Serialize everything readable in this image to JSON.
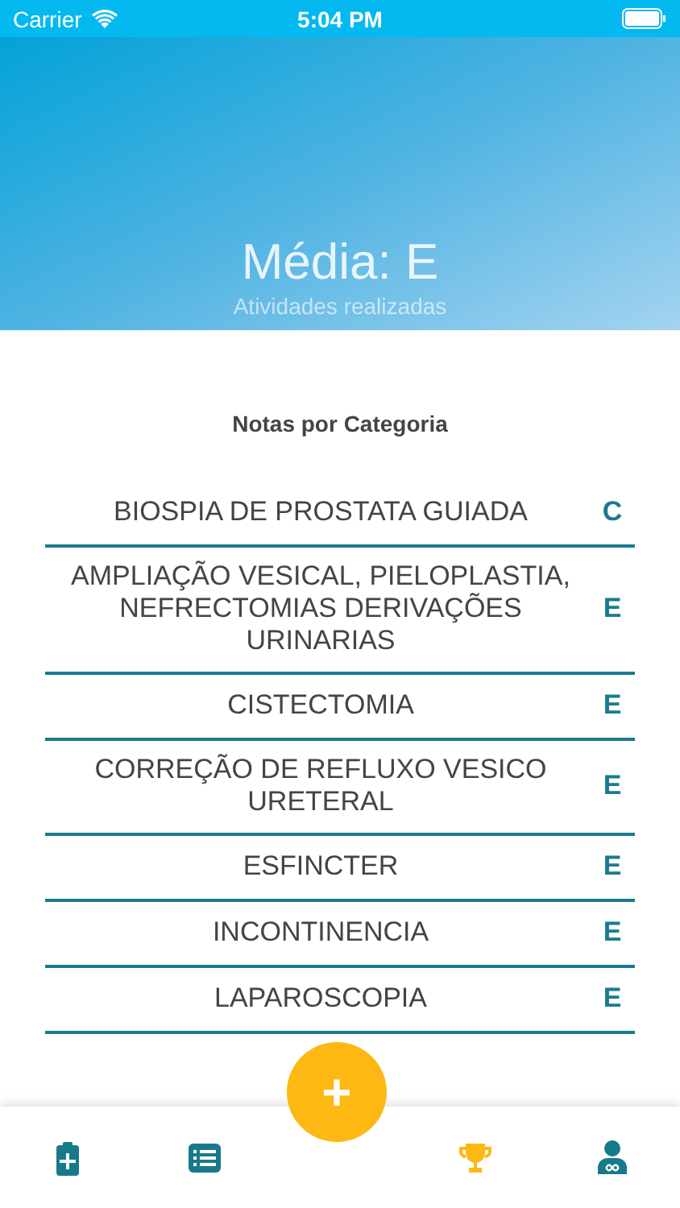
{
  "status_bar": {
    "carrier": "Carrier",
    "time": "5:04 PM"
  },
  "header": {
    "title": "Média: E",
    "subtitle": "Atividades realizadas"
  },
  "section_title": "Notas por Categoria",
  "categories": [
    {
      "name": "BIOSPIA DE PROSTATA GUIADA",
      "grade": "C"
    },
    {
      "name": "AMPLIAÇÃO VESICAL, PIELOPLASTIA, NEFRECTOMIAS DERIVAÇÕES URINARIAS",
      "grade": "E"
    },
    {
      "name": "CISTECTOMIA",
      "grade": "E"
    },
    {
      "name": "CORREÇÃO DE REFLUXO VESICO URETERAL",
      "grade": "E"
    },
    {
      "name": "ESFINCTER",
      "grade": "E"
    },
    {
      "name": "INCONTINENCIA",
      "grade": "E"
    },
    {
      "name": "LAPAROSCOPIA",
      "grade": "E"
    }
  ],
  "tab_bar": [
    {
      "selected": false
    },
    {
      "selected": false
    },
    {
      "selected": true
    },
    {
      "selected": false
    }
  ],
  "add_button": {
    "label": "+"
  }
}
